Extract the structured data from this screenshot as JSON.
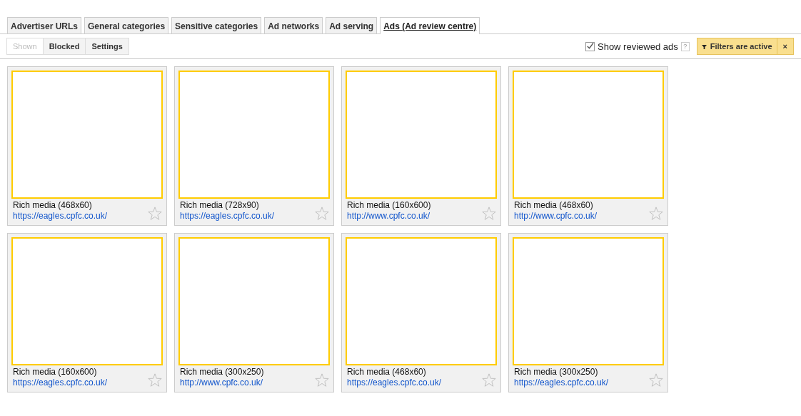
{
  "tabs": [
    {
      "label": "Advertiser URLs",
      "selected": false
    },
    {
      "label": "General categories",
      "selected": false
    },
    {
      "label": "Sensitive categories",
      "selected": false
    },
    {
      "label": "Ad networks",
      "selected": false
    },
    {
      "label": "Ad serving",
      "selected": false
    },
    {
      "label": "Ads (Ad review centre)",
      "selected": true
    }
  ],
  "view_buttons": [
    {
      "label": "Shown",
      "selected": true
    },
    {
      "label": "Blocked",
      "selected": false
    },
    {
      "label": "Settings",
      "selected": false
    }
  ],
  "show_reviewed": {
    "label": "Show reviewed ads",
    "checked": true,
    "help": "?"
  },
  "filters": {
    "label": "Filters are active",
    "clear": "×"
  },
  "ads": [
    {
      "title": "Rich media (468x60)",
      "url": "https://eagles.cpfc.co.uk/",
      "starred": false
    },
    {
      "title": "Rich media (728x90)",
      "url": "https://eagles.cpfc.co.uk/",
      "starred": false
    },
    {
      "title": "Rich media (160x600)",
      "url": "http://www.cpfc.co.uk/",
      "starred": false
    },
    {
      "title": "Rich media (468x60)",
      "url": "http://www.cpfc.co.uk/",
      "starred": false
    },
    {
      "title": "Rich media (160x600)",
      "url": "https://eagles.cpfc.co.uk/",
      "starred": false
    },
    {
      "title": "Rich media (300x250)",
      "url": "http://www.cpfc.co.uk/",
      "starred": false
    },
    {
      "title": "Rich media (468x60)",
      "url": "https://eagles.cpfc.co.uk/",
      "starred": false
    },
    {
      "title": "Rich media (300x250)",
      "url": "https://eagles.cpfc.co.uk/",
      "starred": false
    }
  ]
}
